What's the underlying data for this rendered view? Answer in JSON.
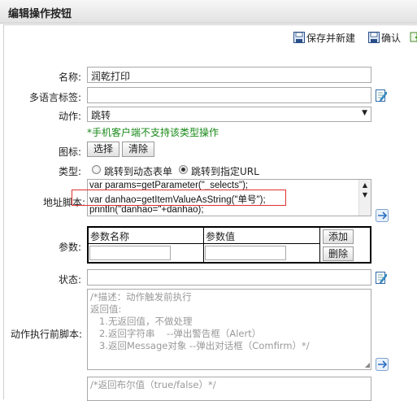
{
  "window": {
    "title": "编辑操作按钮"
  },
  "toolbar": {
    "save_new_label": "保存并新建",
    "confirm_label": "确认"
  },
  "form": {
    "name": {
      "label": "名称:",
      "value": "润乾打印"
    },
    "i18n": {
      "label": "多语言标签:",
      "value": ""
    },
    "action": {
      "label": "动作:",
      "value": "跳转",
      "note": "*手机客户端不支持该类型操作"
    },
    "icon": {
      "label": "图标:",
      "select_label": "选择",
      "clear_label": "清除"
    },
    "type": {
      "label": "类型:",
      "options": [
        "跳转到动态表单",
        "跳转到指定URL"
      ],
      "selected": 1
    },
    "url_script": {
      "label": "地址脚本:",
      "lines": [
        "var params=getParameter(\"_selects\");",
        "var danhao=getItemValueAsString(\"单号\");",
        "println(\"danhao=\"+danhao);"
      ]
    },
    "params": {
      "label": "参数:",
      "col_name": "参数名称",
      "col_value": "参数值",
      "add_label": "添加",
      "delete_label": "删除"
    },
    "state": {
      "label": "状态:",
      "value": ""
    },
    "pre_script": {
      "label": "动作执行前脚本:",
      "lines": [
        "/*描述：动作触发前执行",
        "返回值:",
        "   1.无返回值，不做处理",
        "   2.返回字符串    --弹出警告框（Alert）",
        "   3.返回Message对象 --弹出对话框（Comfirm）*/"
      ]
    },
    "bottom_script": {
      "lines": [
        "/*返回布尔值（true/false）*/"
      ]
    }
  },
  "colors": {
    "highlight": "#e03030",
    "note": "#1a8a1a"
  }
}
